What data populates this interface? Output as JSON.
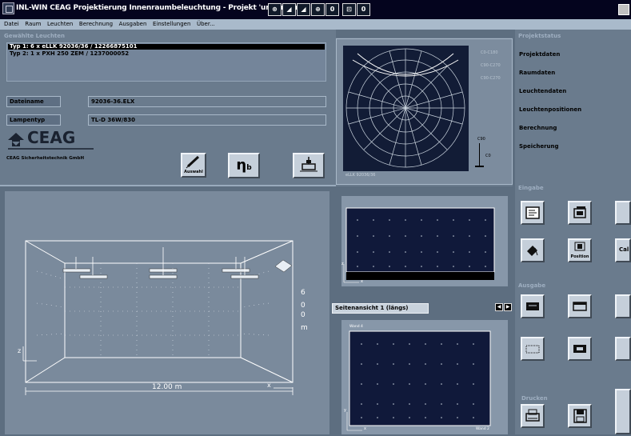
{
  "window": {
    "title": "INL-WIN  CEAG  Projektierung Innenraumbeleuchtung - Projekt 'unbenannt'",
    "toolbar_glyphs": [
      "⊛",
      "◢",
      "◢",
      "⊕",
      "0",
      "⊡",
      "0"
    ]
  },
  "menu": {
    "items": [
      "Datei",
      "Raum",
      "Leuchten",
      "Berechnung",
      "Ausgaben",
      "Einstellungen",
      "Über..."
    ]
  },
  "lamps": {
    "section_title": "Gewählte Leuchten",
    "items": [
      "Typ 1: 6 x eLLK 92036/36 / 12266875101",
      "Typ 2: 1 x PXH 250 ZEM / 1237000052"
    ]
  },
  "fields": {
    "dateiname_label": "Dateiname",
    "dateiname_value": "92036-36.ELX",
    "lampentyp_label": "Lampentyp",
    "lampentyp_value": "TL-D 36W/830"
  },
  "logo": {
    "name": "CEAG",
    "subtitle": "CEAG Sicherheitstechnik GmbH"
  },
  "buttons": {
    "auswahl": "Auswahl",
    "eta": "η",
    "eta_sub": "b"
  },
  "ldc": {
    "labels": [
      "C0-C180",
      "C90-C270",
      "C90-C270"
    ],
    "scale_top": "C90",
    "scale_mid": "C0",
    "caption": "eLLK 92036/36"
  },
  "project_status": {
    "title": "Projektstatus",
    "items": [
      "Projektdaten",
      "Raumdaten",
      "Leuchtendaten",
      "Leuchtenpositionen",
      "Berechnung",
      "Speicherung"
    ]
  },
  "view3d": {
    "width_label": "12.00 m",
    "height_label": [
      "6",
      "0",
      "0",
      "m"
    ],
    "z_label": "z",
    "x_label": "x"
  },
  "side": {
    "view_label": "Seitenansicht 1 (längs)",
    "top_axis_z": "z",
    "top_axis_x": "x",
    "wand4": "Wand 4",
    "wand2": "Wand 2",
    "bot_axis_y": "y",
    "bot_axis_x": "x"
  },
  "right": {
    "eingabe": "Eingabe",
    "ausgabe": "Ausgabe",
    "drucken": "Drucken",
    "position": "Position",
    "cal": "Cal"
  }
}
